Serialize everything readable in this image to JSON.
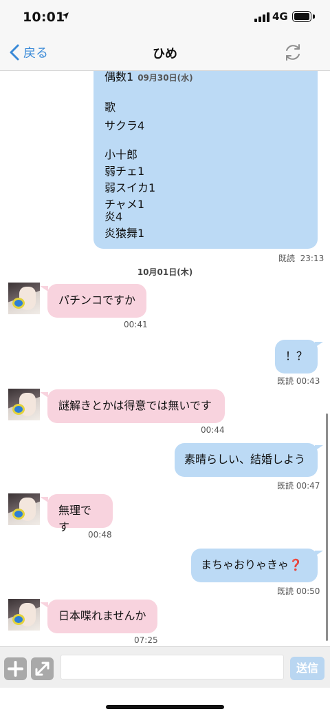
{
  "status_bar": {
    "time": "10:01",
    "network": "4G",
    "location_icon": "location-arrow-icon",
    "battery_level": 0.95
  },
  "nav": {
    "back_label": "戻る",
    "title": "ひめ",
    "back_icon": "chevron-left-icon",
    "refresh_icon": "refresh-icon"
  },
  "messages": {
    "big": {
      "lines": [
        "偶数1",
        "歌",
        "サクラ4",
        "小十郎",
        "弱チェ1",
        "弱スイカ1",
        "チャメ1",
        "炎4",
        "炎猿舞1"
      ],
      "inline_date": "09月30日(水)",
      "read": "既読",
      "time": "23:13"
    },
    "date_separator": "10月01日(木)",
    "m1": {
      "text": "パチンコですか",
      "time": "00:41"
    },
    "m2": {
      "text": "！？",
      "read": "既読",
      "time": "00:43"
    },
    "m3": {
      "text": "謎解きとかは得意では無いです",
      "time": "00:44"
    },
    "m4": {
      "text": "素晴らしい、結婚しよう",
      "read": "既読",
      "time": "00:47"
    },
    "m5": {
      "text": "無理です",
      "time": "00:48"
    },
    "m6": {
      "text": "まちゃおりゃきゃ",
      "emoji": "❓",
      "read": "既読",
      "time": "00:50"
    },
    "m7": {
      "text": "日本喋れませんか",
      "time": "07:25"
    }
  },
  "input_bar": {
    "plus_icon": "plus-icon",
    "expand_icon": "expand-icon",
    "placeholder": "",
    "send_label": "送信"
  },
  "colors": {
    "outgoing": "#bcdaf5",
    "incoming": "#f8d3de",
    "accent": "#3a8ad8"
  }
}
